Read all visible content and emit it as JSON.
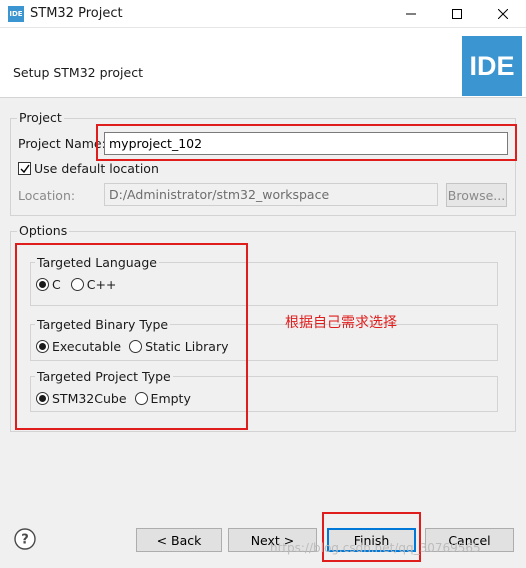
{
  "window": {
    "title": "STM32 Project",
    "app_icon_text": "IDE"
  },
  "header": {
    "title": "Setup STM32 project",
    "logo_text": "IDE"
  },
  "project_group": {
    "label": "Project",
    "name_label": "Project Name:",
    "name_value": "myproject_102",
    "use_default_label": "Use default location",
    "use_default_checked": true,
    "location_label": "Location:",
    "location_value": "D:/Administrator/stm32_workspace",
    "browse_label": "Browse..."
  },
  "options_group": {
    "label": "Options",
    "language": {
      "label": "Targeted Language",
      "options": [
        "C",
        "C++"
      ],
      "selected": "C"
    },
    "binary": {
      "label": "Targeted Binary Type",
      "options": [
        "Executable",
        "Static Library"
      ],
      "selected": "Executable"
    },
    "project_type": {
      "label": "Targeted Project Type",
      "options": [
        "STM32Cube",
        "Empty"
      ],
      "selected": "STM32Cube"
    }
  },
  "annotation": {
    "text": "根据自己需求选择",
    "color": "#e01d1d"
  },
  "buttons": {
    "back": "< Back",
    "next": "Next >",
    "finish": "Finish",
    "cancel": "Cancel"
  },
  "watermark": "https://blog.csdn.net/qq_30769565",
  "colors": {
    "accent": "#3b95d1",
    "annotation": "#e01d1d"
  }
}
